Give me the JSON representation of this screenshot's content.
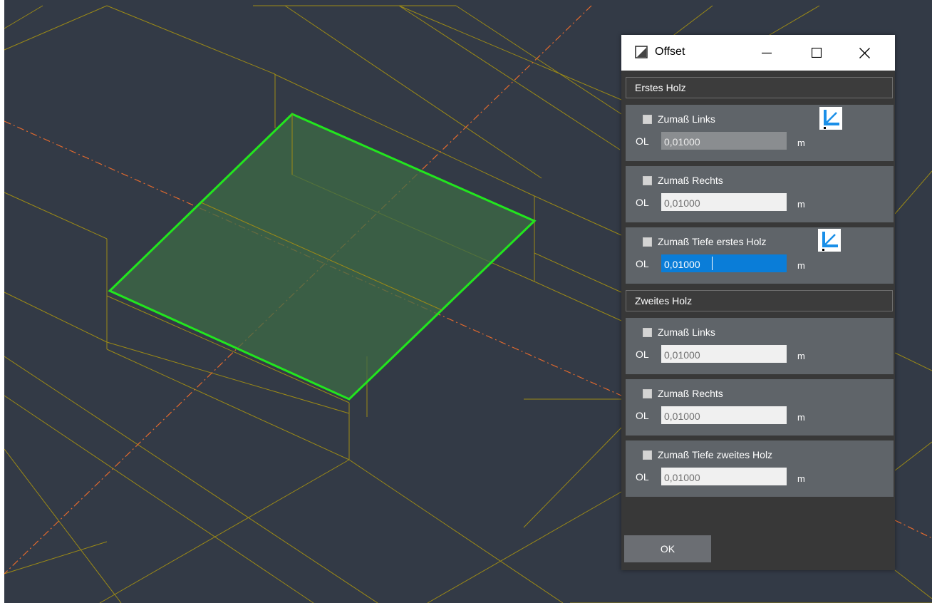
{
  "dialog": {
    "title": "Offset",
    "ok_label": "OK",
    "sections": [
      {
        "header": "Erstes Holz",
        "groups": [
          {
            "checkbox_label": "Zumaß Links",
            "checked": false,
            "field_label": "OL",
            "value": "0,01000",
            "unit": "m",
            "state": "disabled",
            "has_corner_icon": true
          },
          {
            "checkbox_label": "Zumaß Rechts",
            "checked": false,
            "field_label": "OL",
            "value": "0,01000",
            "unit": "m",
            "state": "normal",
            "has_corner_icon": false
          },
          {
            "checkbox_label": "Zumaß Tiefe erstes Holz",
            "checked": false,
            "field_label": "OL",
            "value": "0,01000",
            "unit": "m",
            "state": "focused",
            "has_corner_icon": true
          }
        ]
      },
      {
        "header": "Zweites Holz",
        "groups": [
          {
            "checkbox_label": "Zumaß Links",
            "checked": false,
            "field_label": "OL",
            "value": "0,01000",
            "unit": "m",
            "state": "normal",
            "has_corner_icon": false
          },
          {
            "checkbox_label": "Zumaß Rechts",
            "checked": false,
            "field_label": "OL",
            "value": "0,01000",
            "unit": "m",
            "state": "normal",
            "has_corner_icon": false
          },
          {
            "checkbox_label": "Zumaß Tiefe zweites Holz",
            "checked": false,
            "field_label": "OL",
            "value": "0,01000",
            "unit": "m",
            "state": "normal",
            "has_corner_icon": false
          }
        ]
      }
    ]
  },
  "icons": {
    "title": "offset-icon",
    "corner": "corner-offset-icon",
    "minimize": "minimize-icon",
    "maximize": "maximize-icon",
    "close": "close-icon"
  },
  "colors": {
    "viewport_background": "#333a46",
    "wireframe": "#9c8a16",
    "selection_edge": "#22e61e",
    "selection_fill": "#3d6b45",
    "center_axis": "#e36a2e",
    "input_focus": "#0a7dd8",
    "group_background": "#5f6469"
  }
}
